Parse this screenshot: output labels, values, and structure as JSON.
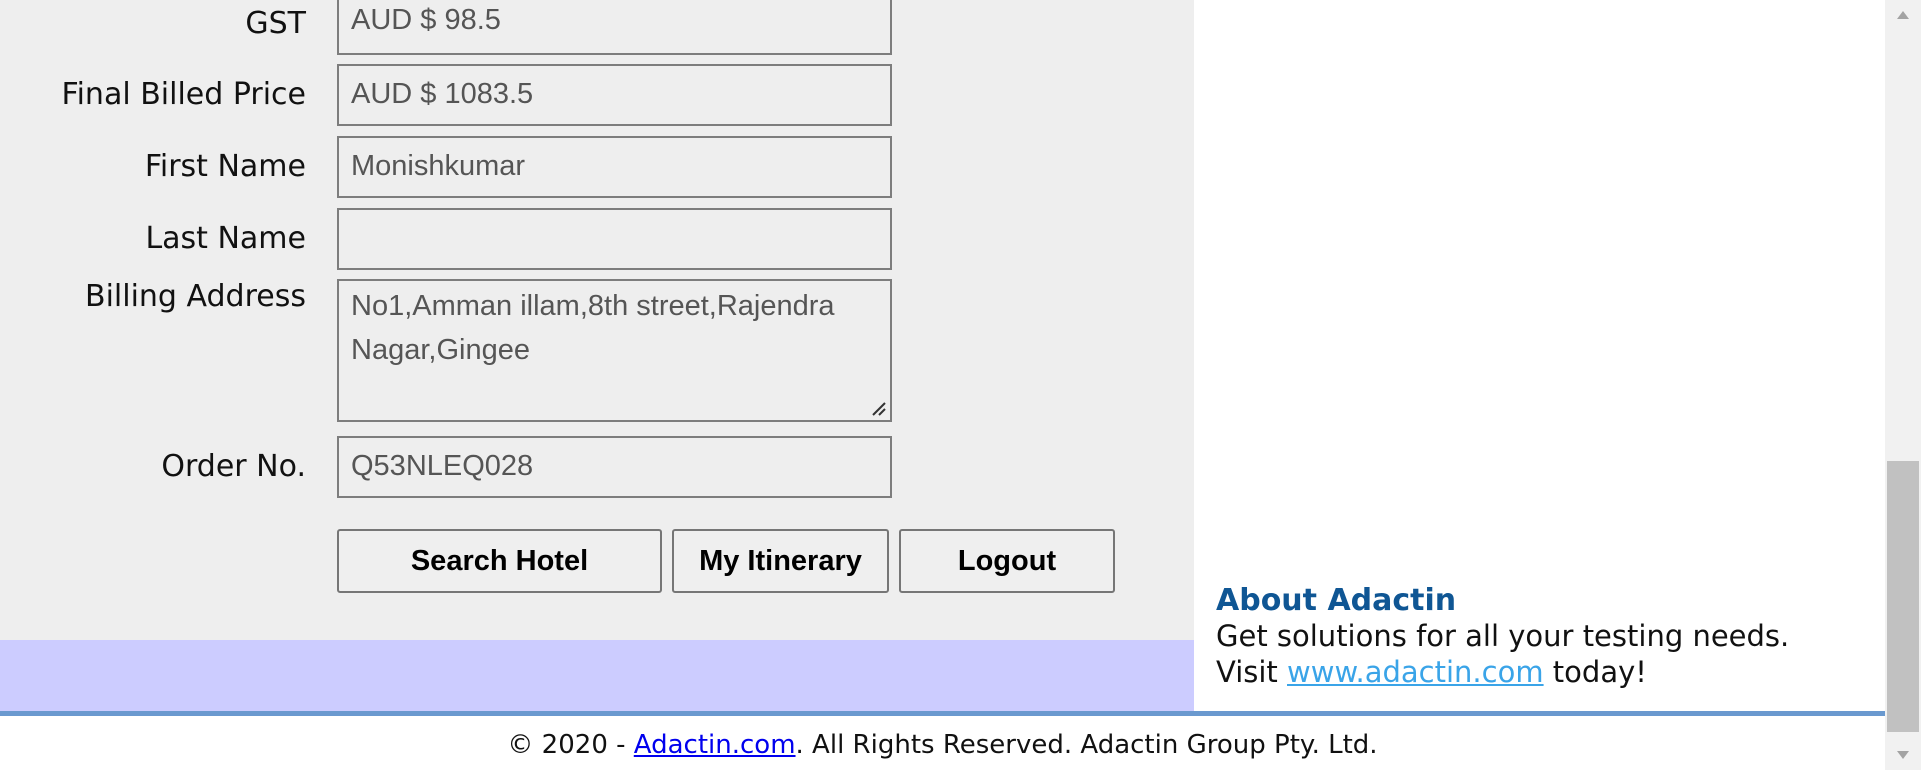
{
  "form": {
    "gst": {
      "label": "GST",
      "value": "AUD $ 98.5"
    },
    "final_price": {
      "label": "Final Billed Price",
      "value": "AUD $ 1083.5"
    },
    "first_name": {
      "label": "First Name",
      "value": "Monishkumar"
    },
    "last_name": {
      "label": "Last Name",
      "value": ""
    },
    "billing_address": {
      "label": "Billing Address",
      "value": "No1,Amman illam,8th street,Rajendra Nagar,Gingee"
    },
    "order_no": {
      "label": "Order No.",
      "value": "Q53NLEQ028"
    }
  },
  "buttons": {
    "search_hotel": "Search Hotel",
    "my_itinerary": "My Itinerary",
    "logout": "Logout"
  },
  "about": {
    "title": "About Adactin",
    "line1": "Get solutions for all your testing needs.",
    "visit_prefix": "Visit ",
    "link_text": "www.adactin.com",
    "visit_suffix": " today!"
  },
  "footer": {
    "prefix": "© 2020 - ",
    "link_text": "Adactin.com",
    "suffix": ". All Rights Reserved. Adactin Group Pty. Ltd."
  },
  "colors": {
    "panel_bg": "#eeeeee",
    "band_bg": "#ccccff",
    "footer_rule": "#6a99cf",
    "about_title": "#0f5694",
    "about_link": "#3aa4e8",
    "footer_link": "#0000ee"
  }
}
